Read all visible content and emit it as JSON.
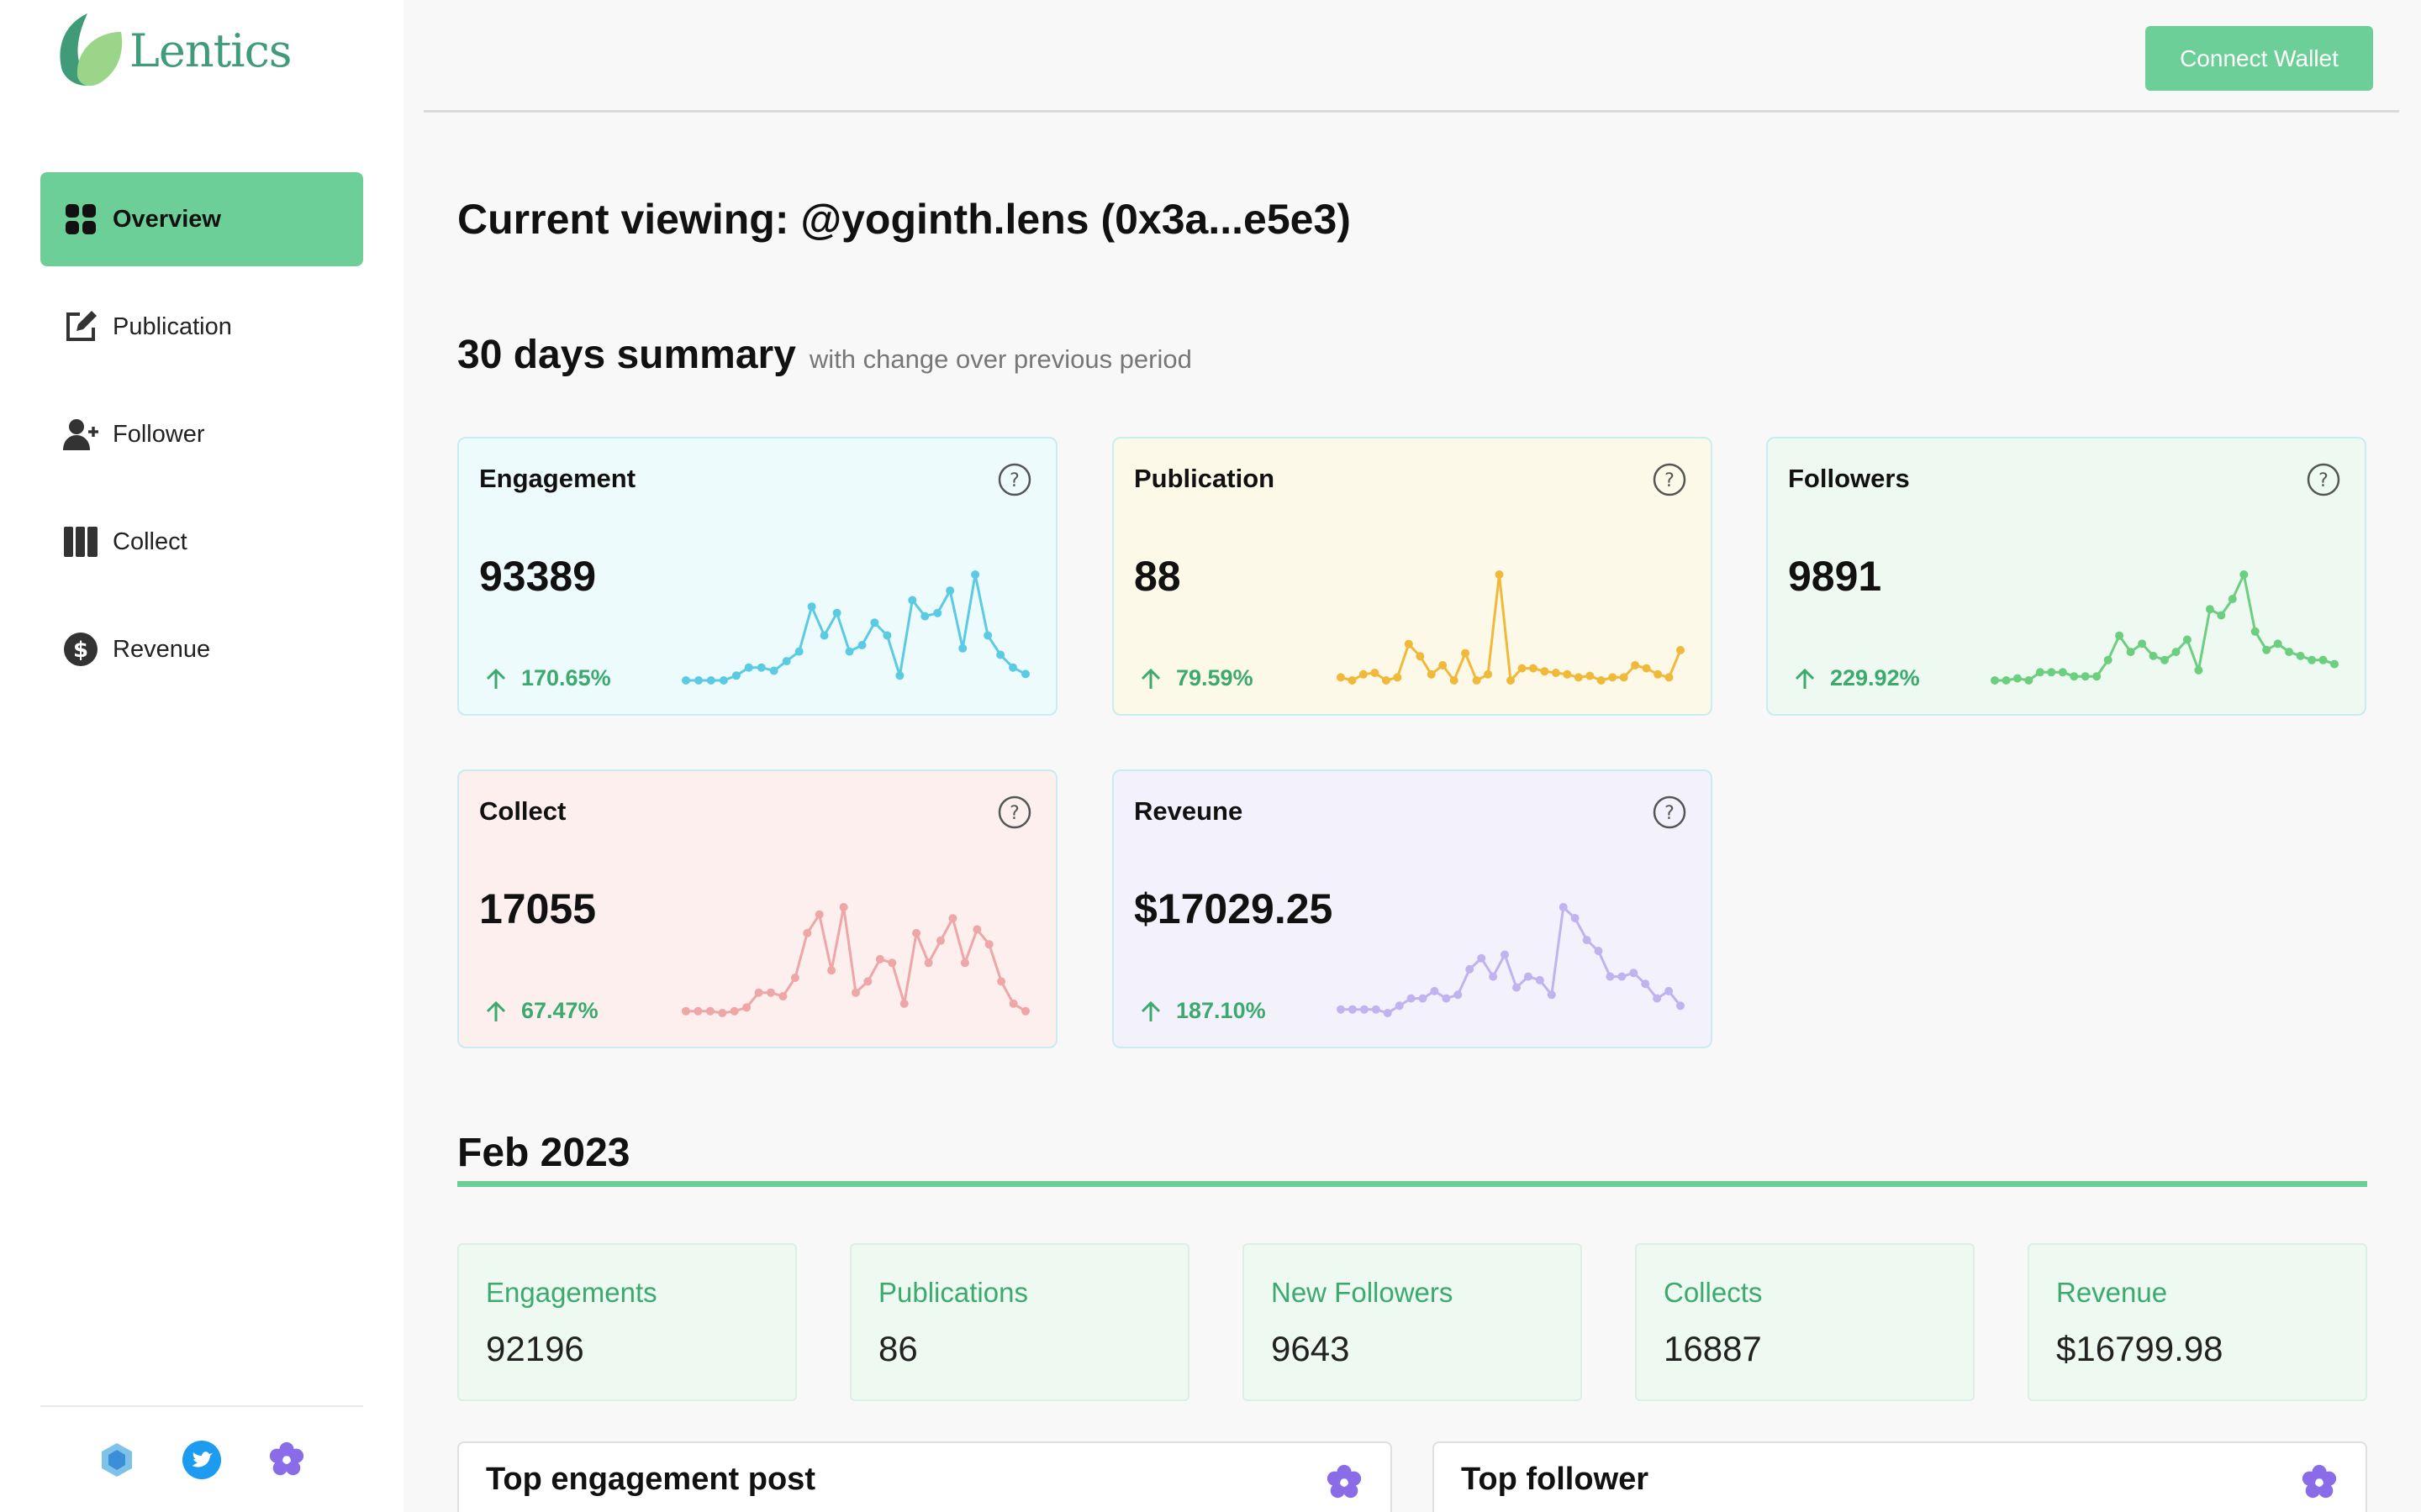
{
  "brand": {
    "name": "Lentics"
  },
  "topbar": {
    "connect_label": "Connect Wallet"
  },
  "sidebar": {
    "items": [
      {
        "label": "Overview",
        "icon": "grid-icon",
        "active": true
      },
      {
        "label": "Publication",
        "icon": "edit-icon",
        "active": false
      },
      {
        "label": "Follower",
        "icon": "user-plus-icon",
        "active": false
      },
      {
        "label": "Collect",
        "icon": "columns-icon",
        "active": false
      },
      {
        "label": "Revenue",
        "icon": "dollar-icon",
        "active": false
      }
    ],
    "footer_icons": [
      "hexagon-logo-icon",
      "twitter-icon",
      "lens-flower-icon"
    ]
  },
  "header": {
    "current_viewing": "Current viewing: @yoginth.lens (0x3a...e5e3)",
    "summary_title": "30 days summary",
    "summary_subtitle": "with change over previous period"
  },
  "cards": [
    {
      "title": "Engagement",
      "value": "93389",
      "change": "170.65%",
      "color": "#5bcbe3",
      "bg": "#eefbfc",
      "series": [
        2,
        2,
        2,
        2,
        5,
        10,
        10,
        8,
        14,
        20,
        48,
        30,
        44,
        20,
        24,
        38,
        30,
        5,
        52,
        42,
        44,
        58,
        22,
        68,
        30,
        18,
        10,
        6
      ]
    },
    {
      "title": "Publication",
      "value": "88",
      "change": "79.59%",
      "color": "#f0b93a",
      "bg": "#fdf9e9",
      "series": [
        2,
        0,
        4,
        5,
        0,
        2,
        24,
        16,
        4,
        10,
        0,
        18,
        0,
        4,
        70,
        0,
        8,
        8,
        6,
        5,
        4,
        2,
        3,
        0,
        2,
        2,
        10,
        8,
        4,
        2,
        20
      ]
    },
    {
      "title": "Followers",
      "value": "9891",
      "change": "229.92%",
      "color": "#6ccf80",
      "bg": "#eef9f2",
      "series": [
        0,
        0,
        1,
        0,
        4,
        4,
        4,
        2,
        2,
        2,
        10,
        22,
        14,
        18,
        12,
        10,
        14,
        20,
        5,
        35,
        32,
        40,
        52,
        24,
        15,
        18,
        14,
        12,
        10,
        10,
        8
      ]
    },
    {
      "title": "Collect",
      "value": "17055",
      "change": "67.47%",
      "color": "#eea6a6",
      "bg": "#fcefee",
      "series": [
        2,
        2,
        2,
        1,
        2,
        4,
        12,
        12,
        10,
        20,
        44,
        54,
        24,
        58,
        12,
        18,
        30,
        28,
        6,
        44,
        28,
        40,
        52,
        28,
        46,
        38,
        18,
        6,
        2
      ]
    },
    {
      "title": "Reveune",
      "value": "$17029.25",
      "change": "187.10%",
      "color": "#c1b3f0",
      "bg": "#f3f2fc",
      "series": [
        2,
        2,
        2,
        2,
        0,
        4,
        8,
        8,
        12,
        8,
        10,
        24,
        30,
        20,
        32,
        14,
        20,
        18,
        10,
        58,
        52,
        40,
        34,
        20,
        20,
        22,
        16,
        8,
        12,
        4
      ]
    }
  ],
  "month": {
    "title": "Feb 2023",
    "stats": [
      {
        "label": "Engagements",
        "value": "92196"
      },
      {
        "label": "Publications",
        "value": "86"
      },
      {
        "label": "New Followers",
        "value": "9643"
      },
      {
        "label": "Collects",
        "value": "16887"
      },
      {
        "label": "Revenue",
        "value": "$16799.98"
      }
    ]
  },
  "bottom": {
    "top_post_title": "Top engagement post",
    "top_follower_title": "Top follower"
  },
  "colors": {
    "accent": "#6ccf98",
    "accent_text": "#3caa6e",
    "lens_purple": "#8a6be8"
  }
}
